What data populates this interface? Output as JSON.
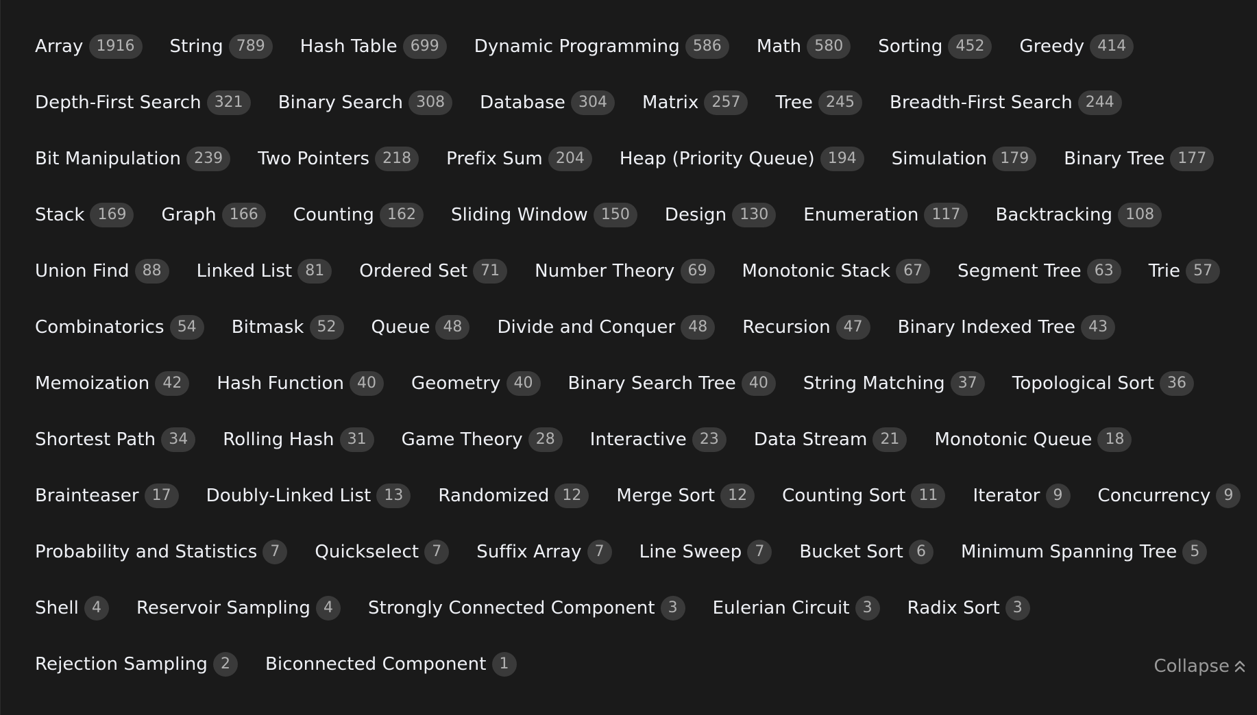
{
  "tags": [
    {
      "name": "Array",
      "count": "1916"
    },
    {
      "name": "String",
      "count": "789"
    },
    {
      "name": "Hash Table",
      "count": "699"
    },
    {
      "name": "Dynamic Programming",
      "count": "586"
    },
    {
      "name": "Math",
      "count": "580"
    },
    {
      "name": "Sorting",
      "count": "452"
    },
    {
      "name": "Greedy",
      "count": "414"
    },
    {
      "name": "Depth-First Search",
      "count": "321"
    },
    {
      "name": "Binary Search",
      "count": "308"
    },
    {
      "name": "Database",
      "count": "304"
    },
    {
      "name": "Matrix",
      "count": "257"
    },
    {
      "name": "Tree",
      "count": "245"
    },
    {
      "name": "Breadth-First Search",
      "count": "244"
    },
    {
      "name": "Bit Manipulation",
      "count": "239"
    },
    {
      "name": "Two Pointers",
      "count": "218"
    },
    {
      "name": "Prefix Sum",
      "count": "204"
    },
    {
      "name": "Heap (Priority Queue)",
      "count": "194"
    },
    {
      "name": "Simulation",
      "count": "179"
    },
    {
      "name": "Binary Tree",
      "count": "177"
    },
    {
      "name": "Stack",
      "count": "169"
    },
    {
      "name": "Graph",
      "count": "166"
    },
    {
      "name": "Counting",
      "count": "162"
    },
    {
      "name": "Sliding Window",
      "count": "150"
    },
    {
      "name": "Design",
      "count": "130"
    },
    {
      "name": "Enumeration",
      "count": "117"
    },
    {
      "name": "Backtracking",
      "count": "108"
    },
    {
      "name": "Union Find",
      "count": "88"
    },
    {
      "name": "Linked List",
      "count": "81"
    },
    {
      "name": "Ordered Set",
      "count": "71"
    },
    {
      "name": "Number Theory",
      "count": "69"
    },
    {
      "name": "Monotonic Stack",
      "count": "67"
    },
    {
      "name": "Segment Tree",
      "count": "63"
    },
    {
      "name": "Trie",
      "count": "57"
    },
    {
      "name": "Combinatorics",
      "count": "54"
    },
    {
      "name": "Bitmask",
      "count": "52"
    },
    {
      "name": "Queue",
      "count": "48"
    },
    {
      "name": "Divide and Conquer",
      "count": "48"
    },
    {
      "name": "Recursion",
      "count": "47"
    },
    {
      "name": "Binary Indexed Tree",
      "count": "43"
    },
    {
      "name": "Memoization",
      "count": "42"
    },
    {
      "name": "Hash Function",
      "count": "40"
    },
    {
      "name": "Geometry",
      "count": "40"
    },
    {
      "name": "Binary Search Tree",
      "count": "40"
    },
    {
      "name": "String Matching",
      "count": "37"
    },
    {
      "name": "Topological Sort",
      "count": "36"
    },
    {
      "name": "Shortest Path",
      "count": "34"
    },
    {
      "name": "Rolling Hash",
      "count": "31"
    },
    {
      "name": "Game Theory",
      "count": "28"
    },
    {
      "name": "Interactive",
      "count": "23"
    },
    {
      "name": "Data Stream",
      "count": "21"
    },
    {
      "name": "Monotonic Queue",
      "count": "18"
    },
    {
      "name": "Brainteaser",
      "count": "17"
    },
    {
      "name": "Doubly-Linked List",
      "count": "13"
    },
    {
      "name": "Randomized",
      "count": "12"
    },
    {
      "name": "Merge Sort",
      "count": "12"
    },
    {
      "name": "Counting Sort",
      "count": "11"
    },
    {
      "name": "Iterator",
      "count": "9"
    },
    {
      "name": "Concurrency",
      "count": "9"
    },
    {
      "name": "Probability and Statistics",
      "count": "7"
    },
    {
      "name": "Quickselect",
      "count": "7"
    },
    {
      "name": "Suffix Array",
      "count": "7"
    },
    {
      "name": "Line Sweep",
      "count": "7"
    },
    {
      "name": "Bucket Sort",
      "count": "6"
    },
    {
      "name": "Minimum Spanning Tree",
      "count": "5"
    },
    {
      "name": "Shell",
      "count": "4"
    },
    {
      "name": "Reservoir Sampling",
      "count": "4"
    },
    {
      "name": "Strongly Connected Component",
      "count": "3"
    },
    {
      "name": "Eulerian Circuit",
      "count": "3"
    },
    {
      "name": "Radix Sort",
      "count": "3"
    },
    {
      "name": "Rejection Sampling",
      "count": "2"
    },
    {
      "name": "Biconnected Component",
      "count": "1"
    }
  ],
  "collapse": {
    "label": "Collapse",
    "icon": "double-chevron-up-icon"
  },
  "colors": {
    "background": "#1a1a1a",
    "tag_text": "#eff1f6",
    "count_background": "#3a3a3a",
    "count_text": "#b3b3b3",
    "collapse_text": "#9a9a9a"
  }
}
